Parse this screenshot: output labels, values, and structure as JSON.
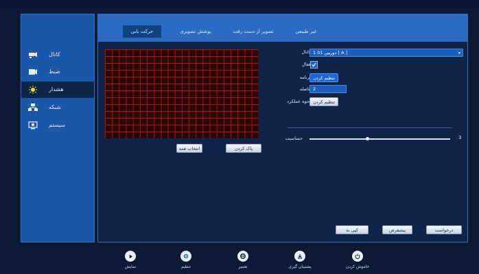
{
  "sidebar": {
    "items": [
      {
        "label": "کانال",
        "icon": "camera-icon"
      },
      {
        "label": "ضبط",
        "icon": "record-icon"
      },
      {
        "label": "هشدار",
        "icon": "alarm-icon"
      },
      {
        "label": "شبکه",
        "icon": "network-icon"
      },
      {
        "label": "سیستم",
        "icon": "system-icon"
      }
    ],
    "active_index": 2
  },
  "tabs": [
    {
      "label": "حرکت یابی"
    },
    {
      "label": "پوشش تصویری"
    },
    {
      "label": "تصویر از دست رفت"
    },
    {
      "label": "غیر طبیعی"
    }
  ],
  "active_tab": 0,
  "form": {
    "channel_label": "کانال",
    "channel_value": "1 دوربین 01 [ A ]",
    "enable_label": "فعال",
    "schedule_label": "برنامه",
    "schedule_button": "تنظیم کردن",
    "interval_label": "فاصله",
    "interval_value": "2",
    "action_label": "نحوه عملکرد",
    "action_button": "تنظیم کردن",
    "sensitivity_label": "حساسیت",
    "sensitivity_value": "3"
  },
  "grid_buttons": {
    "select_all": "انتخاب همه",
    "clear": "پاک کردن"
  },
  "footer_buttons": {
    "request": "درخواست",
    "default": "پیشفرض",
    "copy_to": "کپی به"
  },
  "bottom_nav": [
    {
      "label": "نمایش",
      "icon": "play-icon"
    },
    {
      "label": "تنظیم",
      "icon": "settings-icon"
    },
    {
      "label": "تعمیر",
      "icon": "globe-icon"
    },
    {
      "label": "پشتیبان گیری",
      "icon": "backup-icon"
    },
    {
      "label": "خاموش کردن",
      "icon": "power-icon"
    }
  ],
  "colors": {
    "panel_blue": "#1c58a9",
    "content_dark": "#0f2448",
    "grid_red": "#b31414",
    "accent_blue": "#1d5fc0"
  }
}
